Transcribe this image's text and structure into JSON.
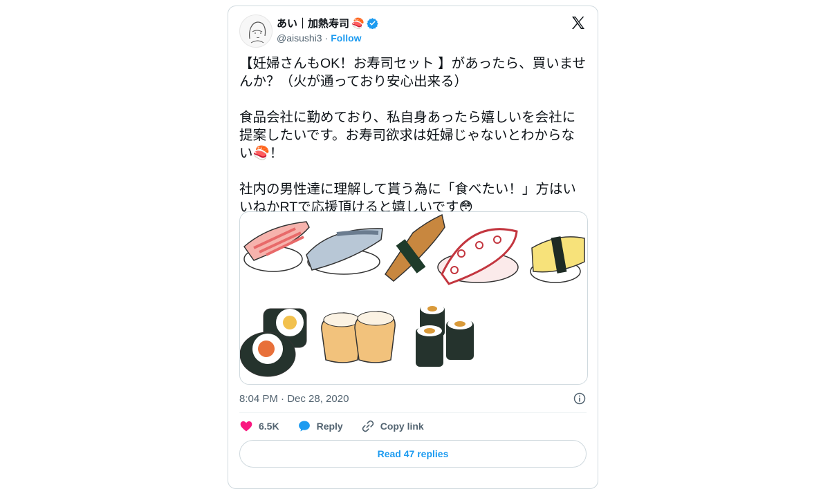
{
  "tweet": {
    "author_name": "あい｜加熱寿司",
    "author_emoji": "🍣",
    "handle": "@aisushi3",
    "separator": "·",
    "follow_label": "Follow",
    "paragraphs": [
      "【妊婦さんもOK！お寿司セット 】があったら、買いませんか？（火が通っており安心出来る）",
      "食品会社に勤めており、私自身あったら嬉しいを会社に提案したいです。お寿司欲求は妊婦じゃないとわからない🍣！",
      "社内の男性達に理解して貰う為に「食べたい！」方はいいねかRTで応援頂けると嬉しいです😳"
    ],
    "timestamp": "8:04 PM · Dec 28, 2020",
    "likes": "6.5K",
    "reply_label": "Reply",
    "copy_link_label": "Copy link",
    "read_replies_label": "Read 47 replies"
  },
  "icons": {
    "verified": "verified-badge-icon",
    "x_logo": "x-logo-icon",
    "info": "info-icon",
    "like": "heart-icon",
    "reply": "reply-bubble-icon",
    "copy": "link-icon"
  },
  "colors": {
    "accent": "#1d9bf0",
    "like": "#f91880",
    "muted": "#536471",
    "border": "#cfd9de"
  }
}
